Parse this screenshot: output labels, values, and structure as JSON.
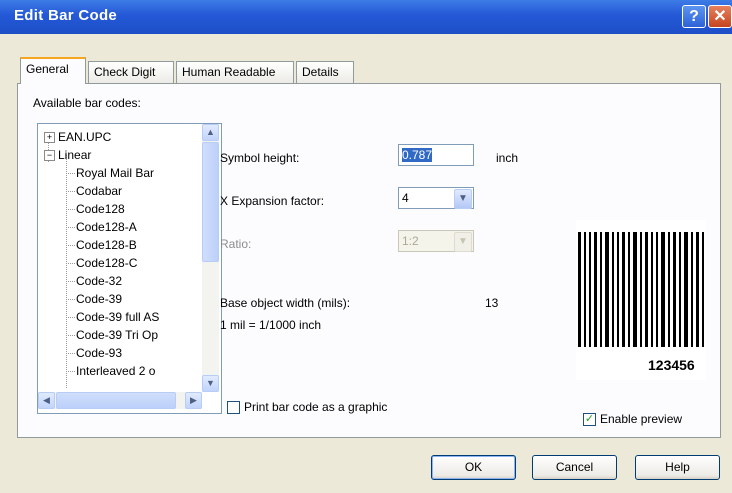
{
  "window": {
    "title": "Edit Bar Code",
    "help_glyph": "?",
    "close_glyph": "✕"
  },
  "tabs": [
    {
      "label": "General",
      "active": true
    },
    {
      "label": "Check Digit",
      "active": false
    },
    {
      "label": "Human Readable",
      "active": false
    },
    {
      "label": "Details",
      "active": false
    }
  ],
  "available_label": "Available bar codes:",
  "tree": {
    "items": [
      {
        "label": "EAN.UPC",
        "expander": "+"
      },
      {
        "label": "Linear",
        "expander": "−"
      },
      {
        "label": "Royal Mail Bar"
      },
      {
        "label": "Codabar"
      },
      {
        "label": "Code128"
      },
      {
        "label": "Code128-A"
      },
      {
        "label": "Code128-B"
      },
      {
        "label": "Code128-C"
      },
      {
        "label": "Code-32"
      },
      {
        "label": "Code-39"
      },
      {
        "label": "Code-39 full AS"
      },
      {
        "label": "Code-39 Tri Op"
      },
      {
        "label": "Code-93"
      },
      {
        "label": "Interleaved 2 o"
      }
    ],
    "scroll_up": "▲",
    "scroll_down": "▼",
    "scroll_left": "◀",
    "scroll_right": "▶"
  },
  "symbol_height": {
    "label": "Symbol height:",
    "value": "0.787",
    "unit": "inch"
  },
  "x_expansion": {
    "label": "X Expansion factor:",
    "value": "4",
    "arrow": "▼"
  },
  "ratio": {
    "label": "Ratio:",
    "value": "1:2",
    "arrow": "▼"
  },
  "base_width": {
    "label": "Base object width (mils):",
    "value": "13"
  },
  "mil_note": "1 mil = 1/1000 inch",
  "print_graphic": {
    "label": "Print bar code as a graphic",
    "checked": false
  },
  "preview": {
    "digits": "123456",
    "label": "Enable preview",
    "checked": true,
    "check_glyph": "✓"
  },
  "buttons": {
    "ok": "OK",
    "cancel": "Cancel",
    "help": "Help"
  }
}
